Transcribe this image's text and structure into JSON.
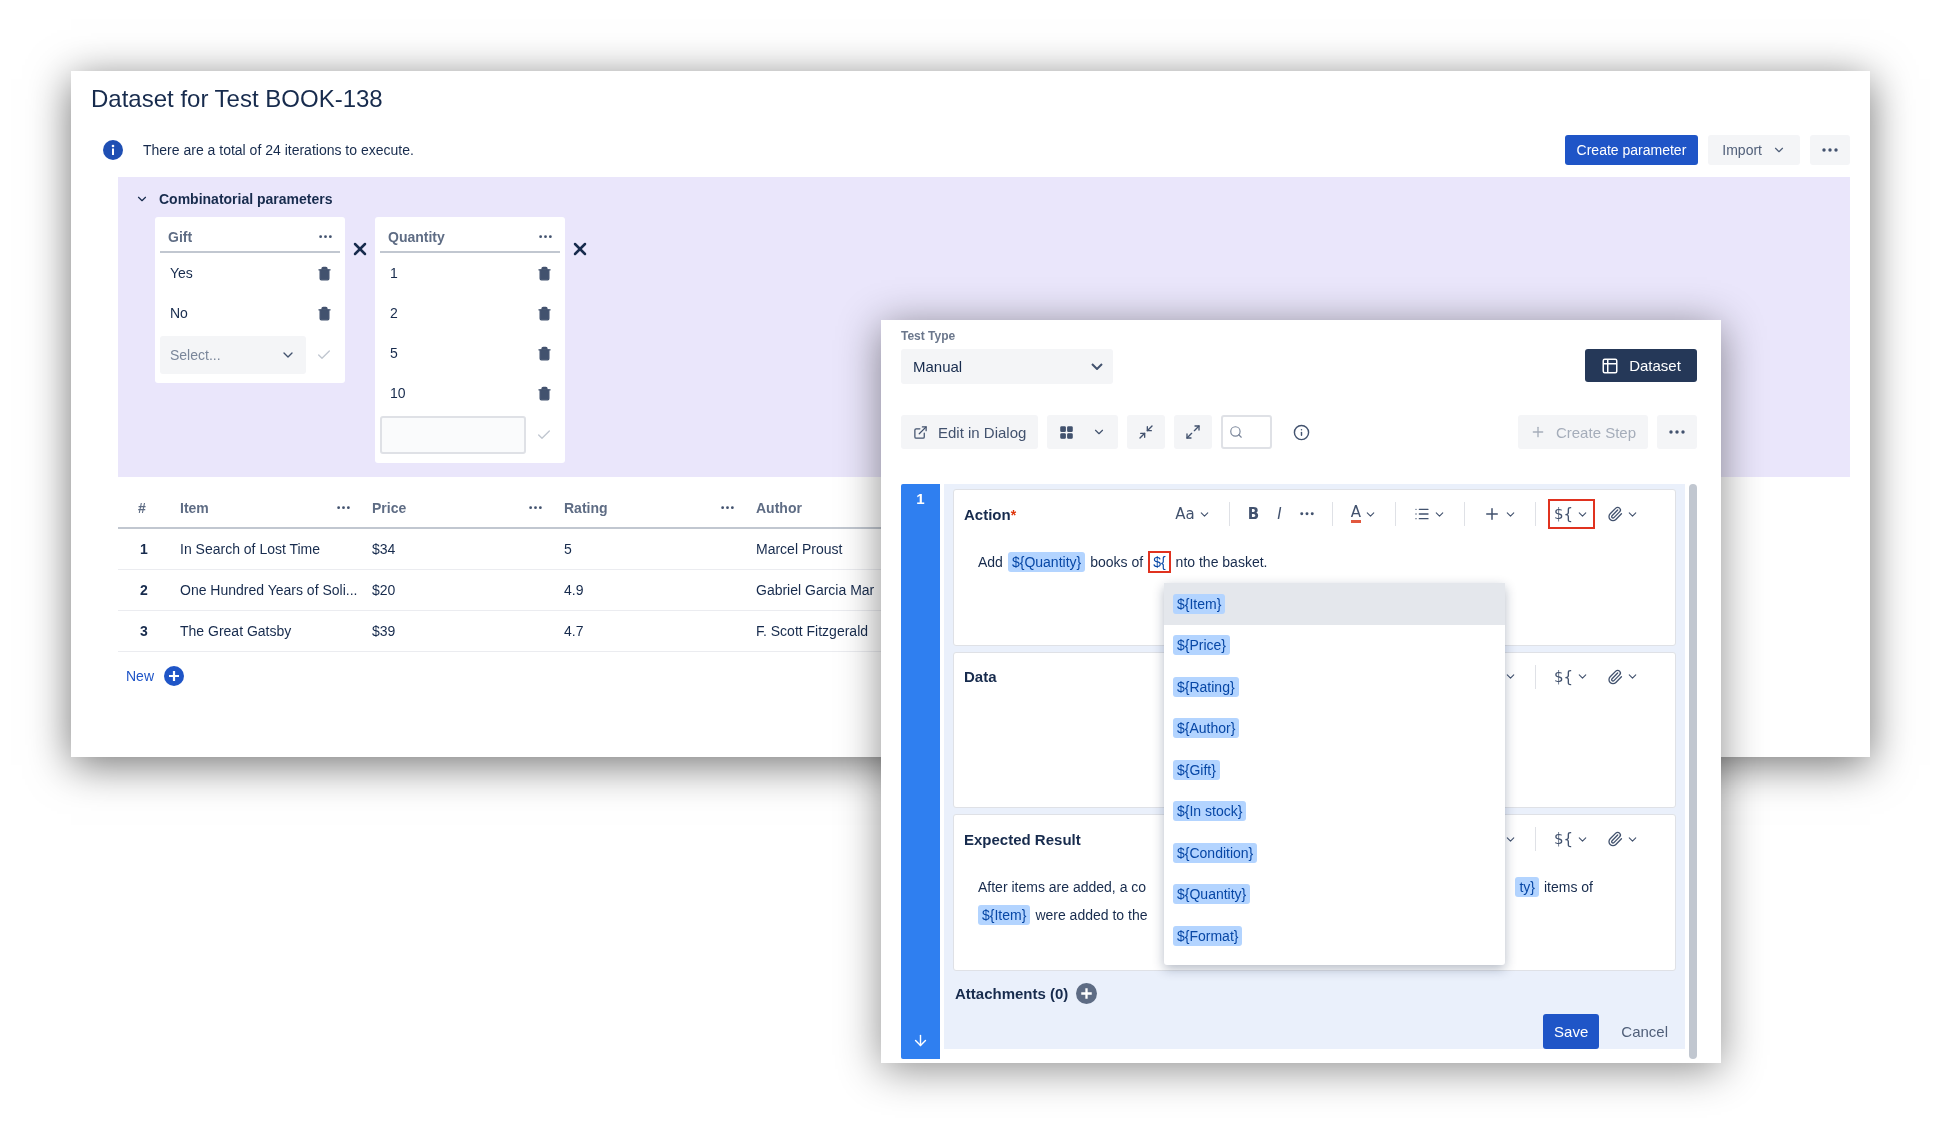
{
  "window": {
    "title": "Dataset for Test BOOK-138",
    "info": "There are a total of 24 iterations to execute.",
    "actions": [
      {
        "kind": "primary",
        "label": "Create parameter"
      },
      {
        "kind": "menu",
        "label": "Import"
      },
      {
        "kind": "more"
      }
    ]
  },
  "combinatorial": {
    "title": "Combinatorial parameters",
    "expanded": true,
    "parameters": [
      {
        "name": "Gift",
        "values": [
          "Yes",
          "No"
        ],
        "new_value": {
          "kind": "select",
          "placeholder": "Select..."
        }
      },
      {
        "name": "Quantity",
        "values": [
          "1",
          "2",
          "5",
          "10"
        ],
        "new_value": {
          "kind": "text"
        }
      }
    ]
  },
  "table": {
    "columns": [
      {
        "label": "#",
        "menu": false
      },
      {
        "label": "Item",
        "menu": true
      },
      {
        "label": "Price",
        "menu": true
      },
      {
        "label": "Rating",
        "menu": true
      },
      {
        "label": "Author",
        "menu": false
      }
    ],
    "rows": [
      [
        "1",
        "In Search of Lost Time",
        "$34",
        "5",
        "Marcel Proust"
      ],
      [
        "2",
        "One Hundred Years of Soli...",
        "$20",
        "4.9",
        "Gabriel Garcia Mar"
      ],
      [
        "3",
        "The Great Gatsby",
        "$39",
        "4.7",
        "F. Scott Fitzgerald"
      ]
    ],
    "new_label": "New"
  },
  "step_editor": {
    "test_type_label": "Test Type",
    "test_type": "Manual",
    "dataset_label": "Dataset",
    "toolbar": {
      "edit_in_dialog": "Edit in Dialog",
      "create_step": {
        "label": "Create Step",
        "disabled": true
      }
    },
    "step_number": "1",
    "sections": [
      {
        "title": "Action",
        "required_mark": "*",
        "tools": [
          {
            "kind": "label",
            "label": "Aa",
            "menu": true,
            "highlighted": false
          },
          {
            "kind": "divider"
          },
          {
            "kind": "bold",
            "label": "B",
            "highlighted": false
          },
          {
            "kind": "italic",
            "label": "I",
            "highlighted": false
          },
          {
            "kind": "more",
            "menu": false,
            "highlighted": false
          },
          {
            "kind": "divider"
          },
          {
            "kind": "color",
            "label": "A",
            "menu": true,
            "highlighted": false
          },
          {
            "kind": "divider"
          },
          {
            "kind": "list",
            "menu": true,
            "highlighted": false
          },
          {
            "kind": "divider"
          },
          {
            "kind": "insert",
            "menu": true,
            "highlighted": false
          },
          {
            "kind": "divider"
          },
          {
            "kind": "label",
            "label": "${",
            "menu": true,
            "highlighted": true
          },
          {
            "kind": "attach",
            "menu": true,
            "highlighted": false
          }
        ],
        "lines": [
          [
            {
              "kind": "text",
              "text": "Add"
            },
            {
              "kind": "chip",
              "text": "${Quantity}"
            },
            {
              "kind": "text",
              "text": "books of"
            },
            {
              "kind": "typing",
              "text": "${"
            },
            {
              "kind": "text",
              "text": "nto the basket."
            }
          ]
        ]
      },
      {
        "title": "Data",
        "tools": [
          {
            "kind": "insert",
            "menu": true,
            "highlighted": false
          },
          {
            "kind": "divider"
          },
          {
            "kind": "label",
            "label": "${",
            "menu": true,
            "highlighted": false
          },
          {
            "kind": "attach",
            "menu": true,
            "highlighted": false
          }
        ]
      },
      {
        "title": "Expected Result",
        "tools": [
          {
            "kind": "insert",
            "menu": true,
            "highlighted": false
          },
          {
            "kind": "divider"
          },
          {
            "kind": "label",
            "label": "${",
            "menu": true,
            "highlighted": false
          },
          {
            "kind": "attach",
            "menu": true,
            "highlighted": false
          }
        ],
        "lines": [
          [
            {
              "kind": "text",
              "text": "After items are added, a co"
            },
            {
              "kind": "gap"
            },
            {
              "kind": "chip",
              "text": "ty}"
            },
            {
              "kind": "text",
              "text": "items of"
            }
          ],
          [
            {
              "kind": "chip",
              "text": "${Item}"
            },
            {
              "kind": "text",
              "text": "were added to the"
            }
          ]
        ]
      }
    ],
    "attachments": "Attachments (0)",
    "save": "Save",
    "cancel": "Cancel"
  },
  "variable_menu": {
    "items": [
      {
        "label": "${Item}",
        "selected": true
      },
      {
        "label": "${Price}",
        "selected": false
      },
      {
        "label": "${Rating}",
        "selected": false
      },
      {
        "label": "${Author}",
        "selected": false
      },
      {
        "label": "${Gift}",
        "selected": false
      },
      {
        "label": "${In stock}",
        "selected": false
      },
      {
        "label": "${Condition}",
        "selected": false
      },
      {
        "label": "${Quantity}",
        "selected": false
      },
      {
        "label": "${Format}",
        "selected": false
      }
    ]
  }
}
